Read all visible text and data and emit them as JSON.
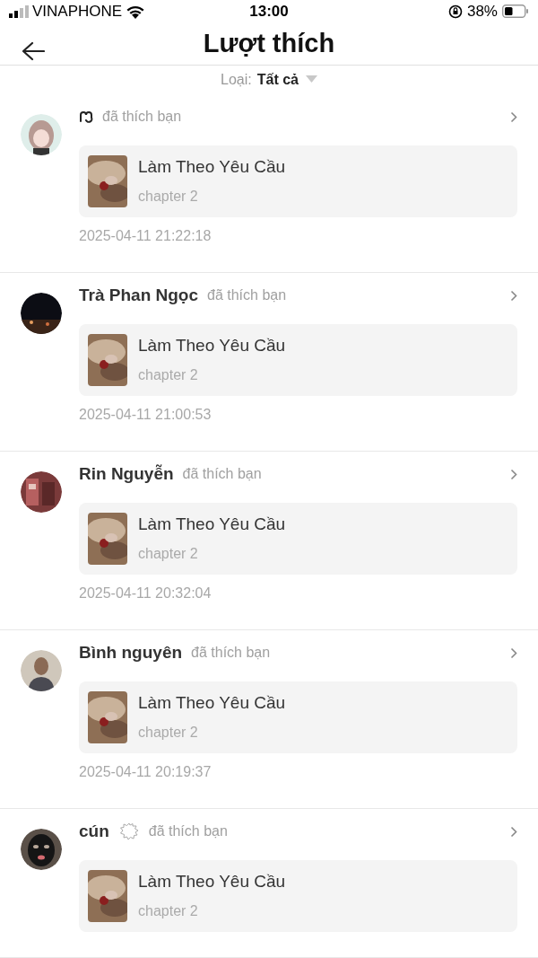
{
  "status_bar": {
    "carrier": "VINAPHONE",
    "time": "13:00",
    "battery": "38%"
  },
  "header": {
    "title": "Lượt thích"
  },
  "filter": {
    "label": "Loại:",
    "value": "Tất cả"
  },
  "items": [
    {
      "kind": "symbol",
      "action": "đã thích bạn",
      "post_title": "Làm Theo Yêu Cầu",
      "chapter": "chapter 2",
      "time": "2025-04-11 21:22:18"
    },
    {
      "kind": "text",
      "name": "Trà Phan Ngọc",
      "action": "đã thích bạn",
      "post_title": "Làm Theo Yêu Cầu",
      "chapter": "chapter 2",
      "time": "2025-04-11 21:00:53"
    },
    {
      "kind": "text",
      "name": "Rin Nguyễn",
      "action": "đã thích bạn",
      "post_title": "Làm Theo Yêu Cầu",
      "chapter": "chapter 2",
      "time": "2025-04-11 20:32:04"
    },
    {
      "kind": "text",
      "name": "Bình nguyên",
      "action": "đã thích bạn",
      "post_title": "Làm Theo Yêu Cầu",
      "chapter": "chapter 2",
      "time": "2025-04-11 20:19:37"
    },
    {
      "kind": "text",
      "name": "cún",
      "badge": true,
      "action": "đã thích bạn",
      "post_title": "Làm Theo Yêu Cầu",
      "chapter": "chapter 2"
    }
  ]
}
